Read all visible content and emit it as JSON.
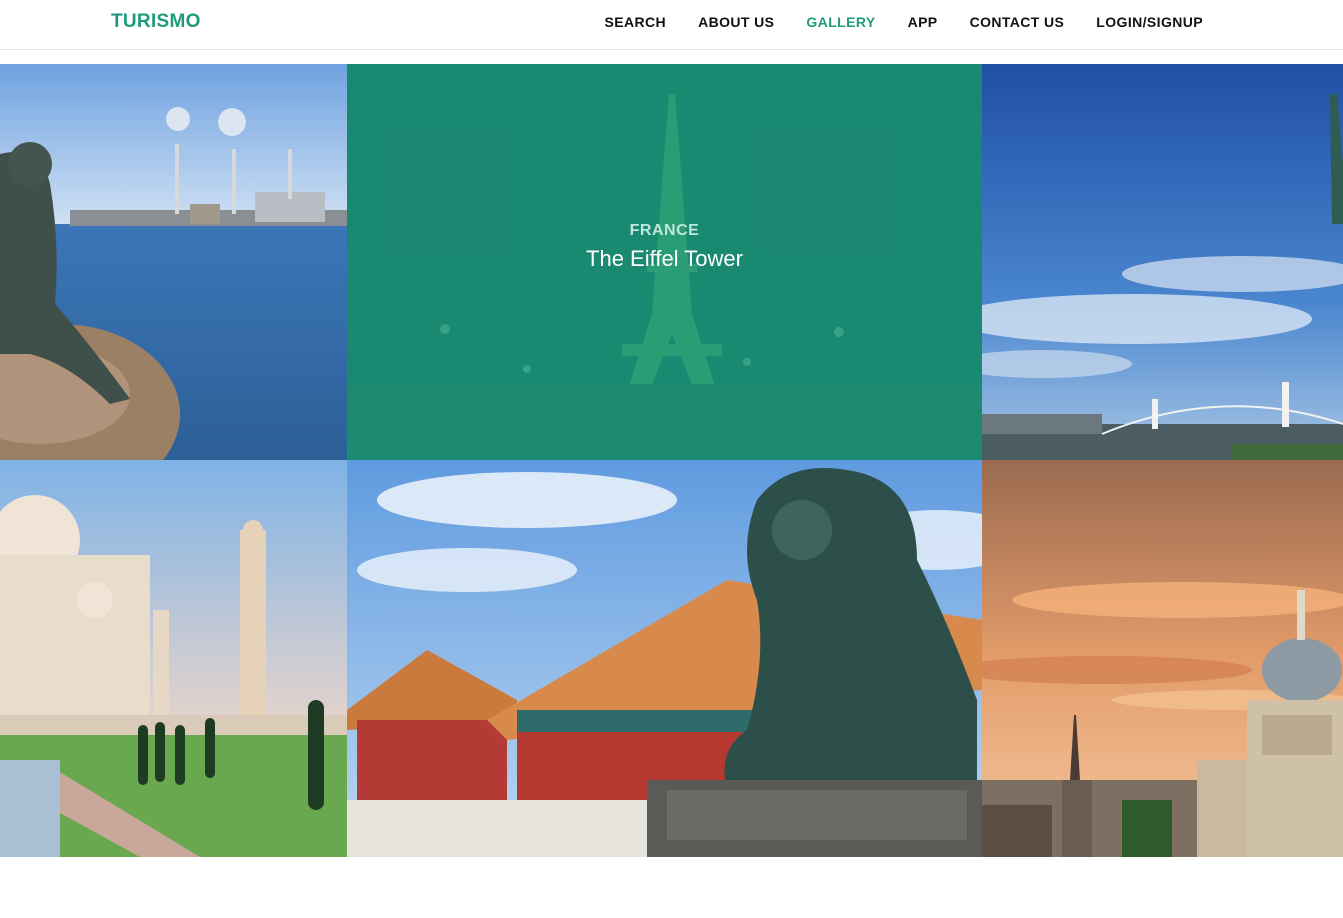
{
  "brand": {
    "name": "TURISMO"
  },
  "nav": {
    "items": [
      {
        "label": "SEARCH"
      },
      {
        "label": "ABOUT US"
      },
      {
        "label": "GALLERY"
      },
      {
        "label": "APP"
      },
      {
        "label": "CONTACT US"
      },
      {
        "label": "LOGIN/SIGNUP"
      }
    ],
    "active_index": 2
  },
  "gallery": {
    "tiles": [
      {
        "subject": "little mermaid statue, copenhagen"
      },
      {
        "subject": "eiffel tower",
        "country": "FRANCE",
        "title": "The Eiffel Tower",
        "hovered": true
      },
      {
        "subject": "statue of liberty and bridge skyline"
      },
      {
        "subject": "taj mahal"
      },
      {
        "subject": "forbidden city guardian lion"
      },
      {
        "subject": "st paul's cathedral, london"
      }
    ]
  },
  "colors": {
    "accent": "#1f9b7c",
    "overlay": "#1b9678",
    "nav_text": "#111111"
  }
}
